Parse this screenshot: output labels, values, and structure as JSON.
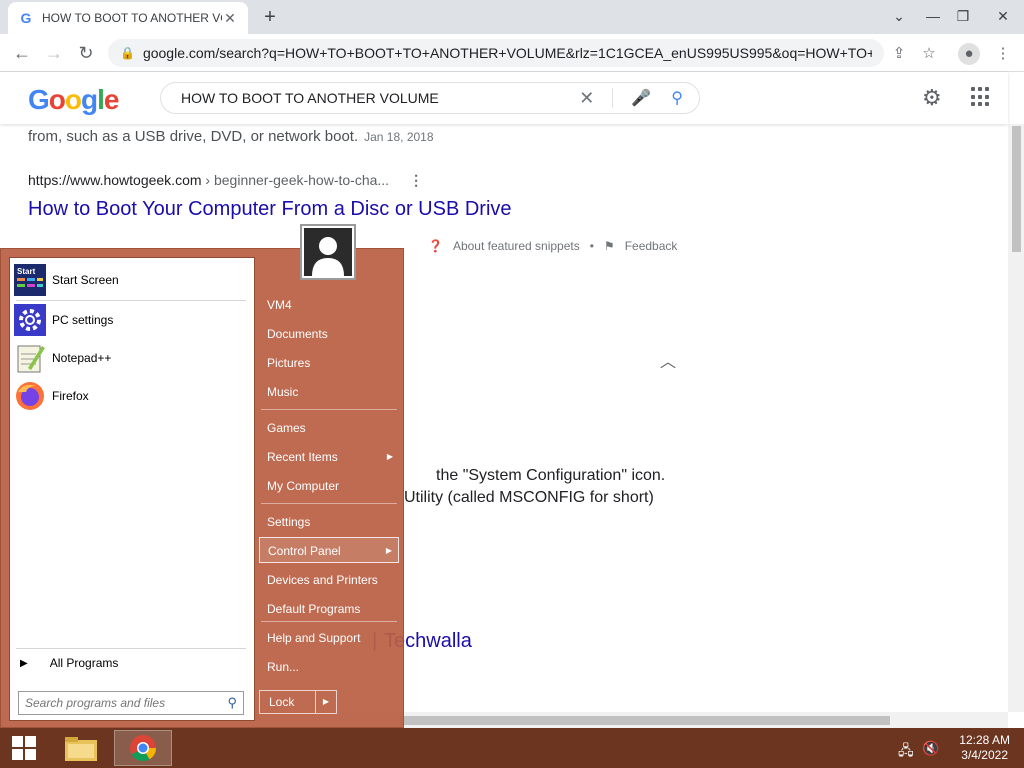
{
  "browser": {
    "tab_title": "HOW TO BOOT TO ANOTHER VOLUME",
    "tab_favicon": "G",
    "url": "google.com/search?q=HOW+TO+BOOT+TO+ANOTHER+VOLUME&rlz=1C1GCEA_enUS995US995&oq=HOW+TO+B..."
  },
  "google": {
    "logo_letters": [
      "G",
      "o",
      "o",
      "g",
      "l",
      "e"
    ],
    "query": "HOW TO BOOT TO ANOTHER VOLUME"
  },
  "result": {
    "snippet_tail": "from, such as a USB drive, DVD, or network boot.",
    "snippet_date": "Jan 18, 2018",
    "cite_domain": "https://www.howtogeek.com",
    "cite_path": " › beginner-geek-how-to-cha...",
    "title": "How to Boot Your Computer From a Disc or USB Drive",
    "about_snippets": "About featured snippets",
    "feedback": "Feedback"
  },
  "partial_text": {
    "line1": "the \"System Configuration\" icon.",
    "line2": "Utility (called MSCONFIG for short)",
    "link_word": "Techwalla",
    "link_sep": "|"
  },
  "start_menu": {
    "pinned": [
      {
        "label": "Start Screen",
        "icon": "start-screen-icon"
      },
      {
        "label": "PC settings",
        "icon": "gear-icon"
      },
      {
        "label": "Notepad++",
        "icon": "notepad-icon"
      },
      {
        "label": "Firefox",
        "icon": "firefox-icon"
      }
    ],
    "start_tile_text": "Start",
    "all_programs": "All Programs",
    "search_placeholder": "Search programs and files",
    "right": [
      "VM4",
      "Documents",
      "Pictures",
      "Music",
      "Games",
      "Recent Items",
      "My Computer",
      "Settings",
      "Control Panel",
      "Devices and Printers",
      "Default Programs",
      "Help and Support",
      "Run..."
    ],
    "lock": "Lock"
  },
  "taskbar": {
    "time": "12:28 AM",
    "date": "3/4/2022"
  }
}
